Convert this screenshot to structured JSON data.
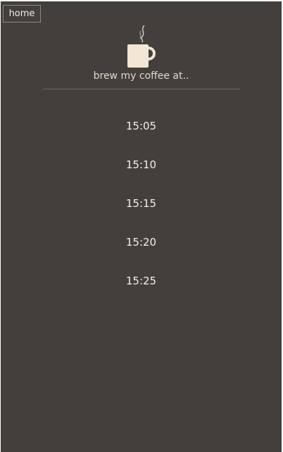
{
  "nav": {
    "home_label": "home"
  },
  "header": {
    "icon": "coffee-cup-icon",
    "subtitle": "brew my coffee at..",
    "cup_color": "#f2e6d4"
  },
  "times": [
    "15:05",
    "15:10",
    "15:15",
    "15:20",
    "15:25"
  ],
  "colors": {
    "background": "#433f3c",
    "text": "#f4f0e8",
    "divider": "#6d6864"
  }
}
